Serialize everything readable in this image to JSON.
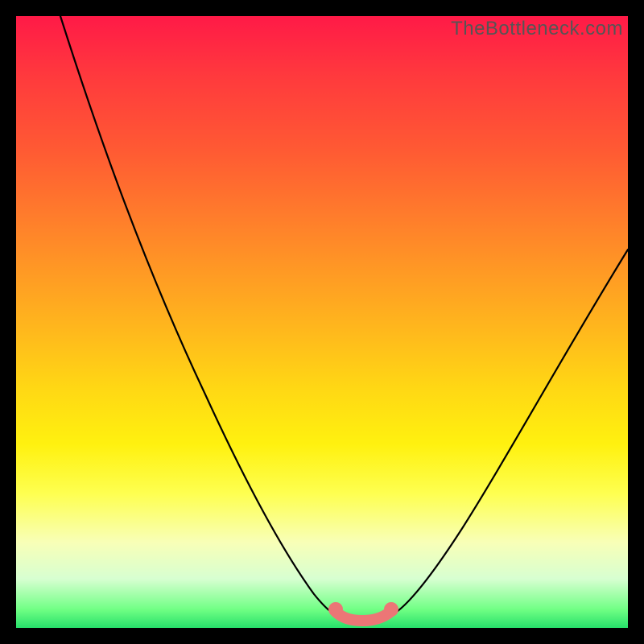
{
  "watermark": "TheBottleneck.com",
  "colors": {
    "frame": "#000000",
    "curve": "#000000",
    "highlight": "#ec7676",
    "gradient_top": "#ff1a47",
    "gradient_bottom": "#26e06a"
  },
  "chart_data": {
    "type": "line",
    "title": "",
    "xlabel": "",
    "ylabel": "",
    "xlim": [
      0,
      100
    ],
    "ylim": [
      0,
      100
    ],
    "grid": false,
    "series": [
      {
        "name": "bottleneck-curve",
        "x": [
          0,
          5,
          10,
          15,
          20,
          25,
          30,
          35,
          40,
          45,
          48,
          50,
          52,
          55,
          58,
          60,
          63,
          67,
          72,
          78,
          85,
          92,
          100
        ],
        "y": [
          100,
          91,
          82,
          73,
          64,
          55,
          46,
          37,
          28,
          18,
          11,
          6,
          3,
          2,
          2,
          3,
          6,
          11,
          18,
          27,
          38,
          49,
          62
        ]
      },
      {
        "name": "optimal-range-highlight",
        "x": [
          50,
          52,
          55,
          58,
          60
        ],
        "y": [
          6,
          3,
          2,
          2,
          3
        ]
      }
    ],
    "annotations": []
  }
}
